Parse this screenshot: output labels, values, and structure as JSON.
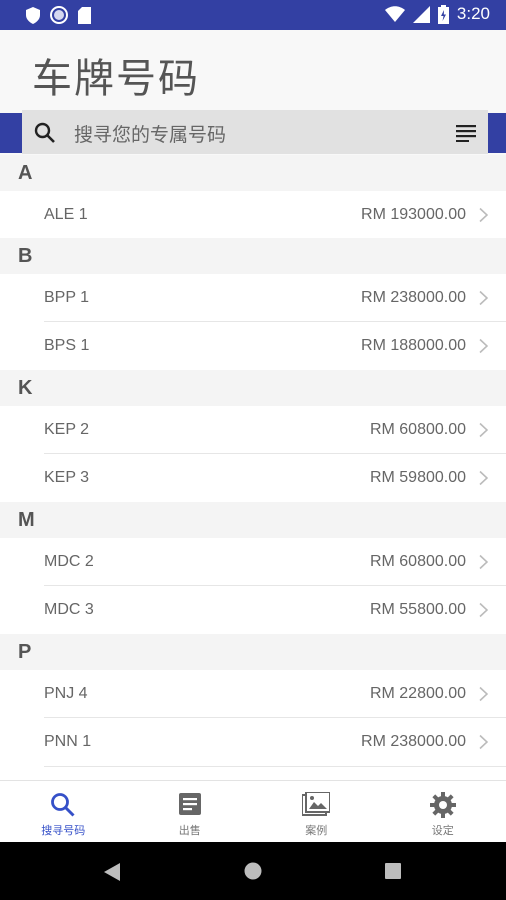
{
  "status_bar": {
    "time": "3:20"
  },
  "header": {
    "title": "车牌号码"
  },
  "search": {
    "placeholder": "搜寻您的专属号码"
  },
  "sections": [
    {
      "letter": "A",
      "rows": [
        {
          "plate": "ALE 1",
          "price": "RM 193000.00"
        }
      ]
    },
    {
      "letter": "B",
      "rows": [
        {
          "plate": "BPP 1",
          "price": "RM 238000.00"
        },
        {
          "plate": "BPS 1",
          "price": "RM 188000.00"
        }
      ]
    },
    {
      "letter": "K",
      "rows": [
        {
          "plate": "KEP 2",
          "price": "RM 60800.00"
        },
        {
          "plate": "KEP 3",
          "price": "RM 59800.00"
        }
      ]
    },
    {
      "letter": "M",
      "rows": [
        {
          "plate": "MDC 2",
          "price": "RM 60800.00"
        },
        {
          "plate": "MDC 3",
          "price": "RM 55800.00"
        }
      ]
    },
    {
      "letter": "P",
      "rows": [
        {
          "plate": "PNJ 4",
          "price": "RM 22800.00"
        },
        {
          "plate": "PNN 1",
          "price": "RM 238000.00"
        }
      ]
    }
  ],
  "bottom_nav": [
    {
      "label": "搜寻号码",
      "icon": "search-icon",
      "active": true
    },
    {
      "label": "出售",
      "icon": "document-icon",
      "active": false
    },
    {
      "label": "案例",
      "icon": "gallery-icon",
      "active": false
    },
    {
      "label": "设定",
      "icon": "gear-icon",
      "active": false
    }
  ],
  "colors": {
    "primary": "#3340a3",
    "active_tab": "#3550c8"
  }
}
